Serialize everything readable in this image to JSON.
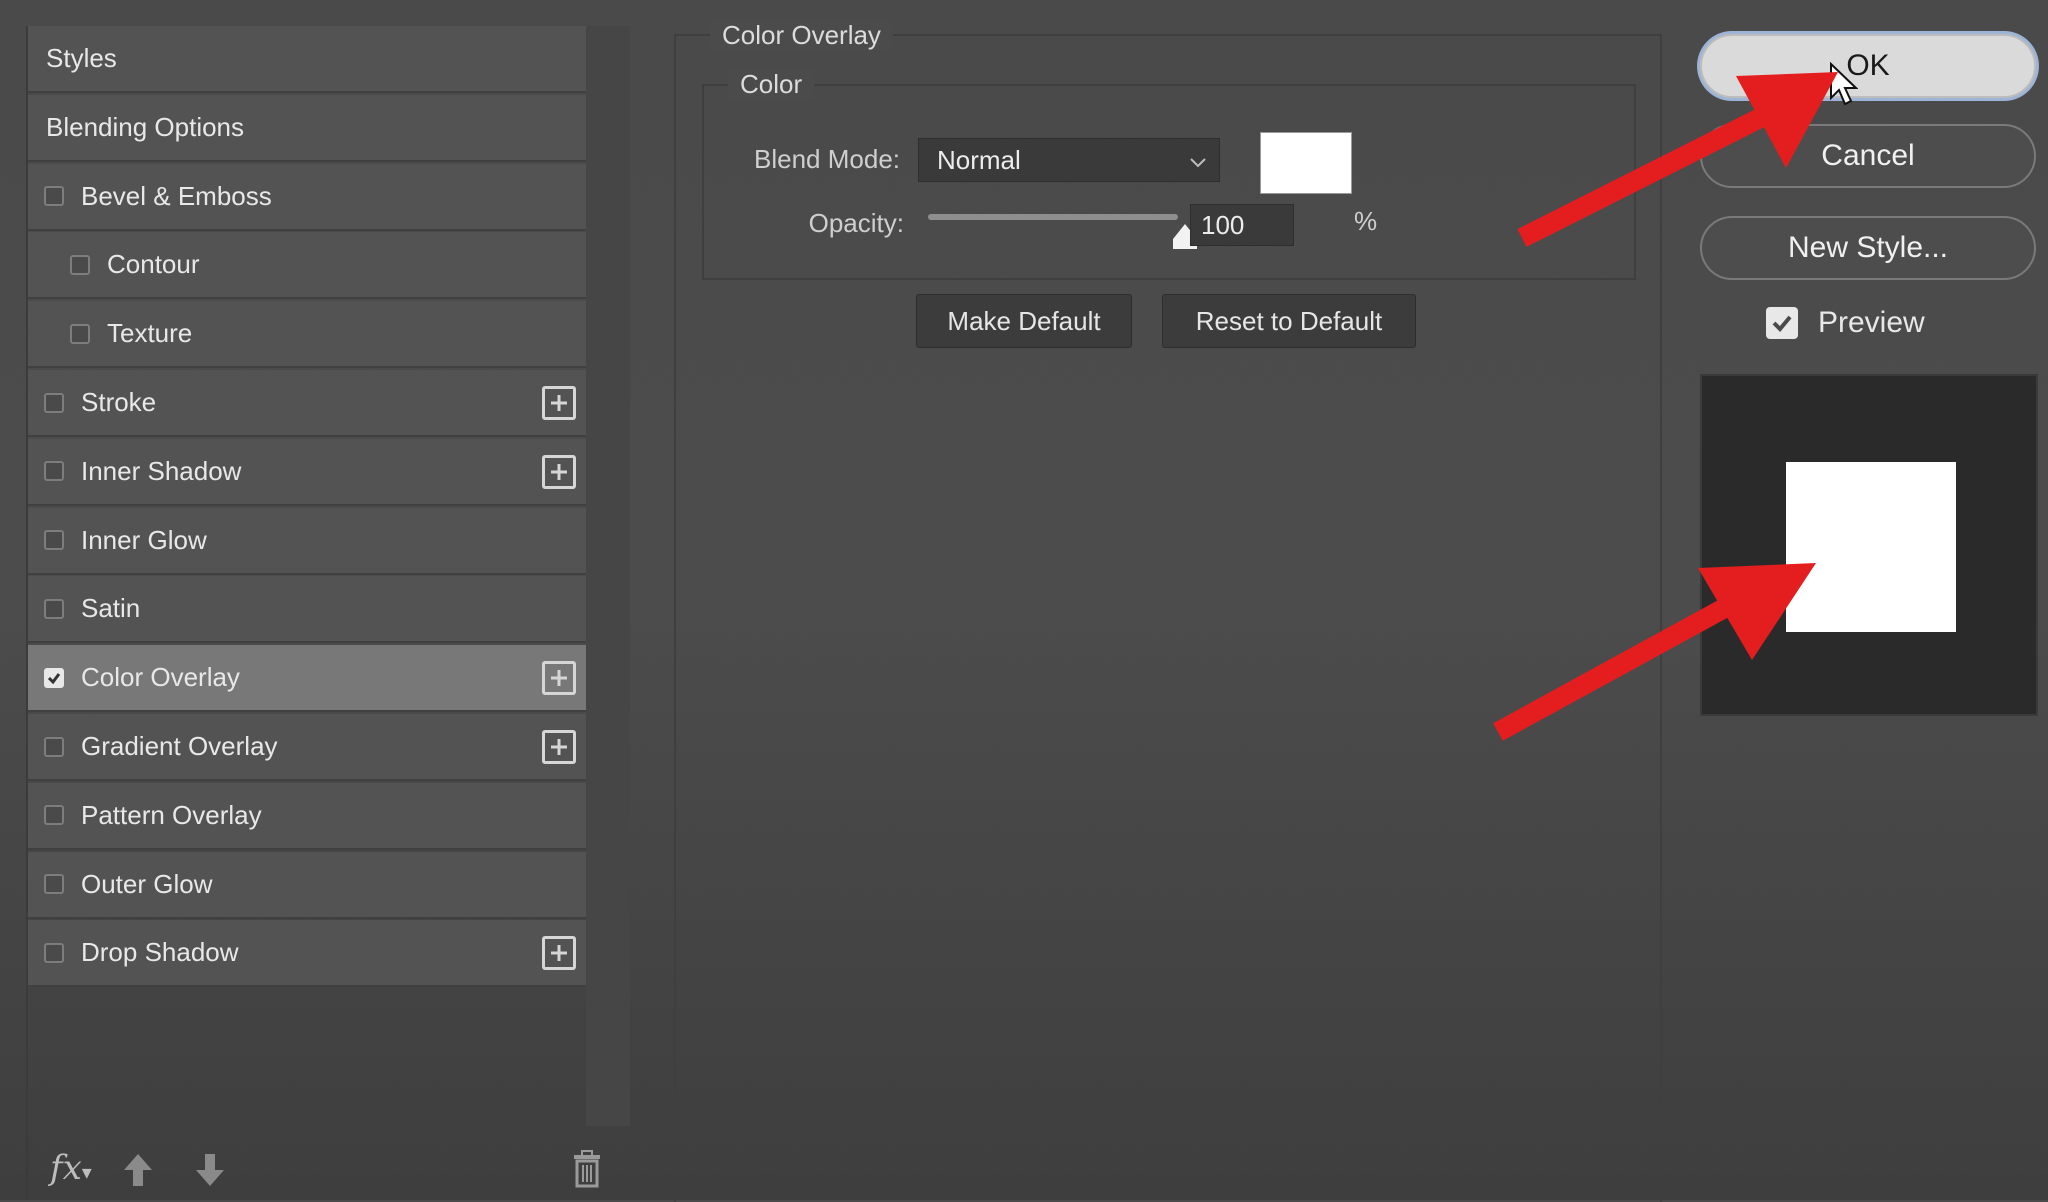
{
  "styles_panel": {
    "items": [
      {
        "label": "Styles",
        "type": "header",
        "indent": 0,
        "checked": false,
        "add": false
      },
      {
        "label": "Blending Options",
        "type": "header",
        "indent": 0,
        "checked": false,
        "add": false
      },
      {
        "label": "Bevel & Emboss",
        "type": "effect",
        "indent": 0,
        "checked": false,
        "add": false
      },
      {
        "label": "Contour",
        "type": "effect",
        "indent": 1,
        "checked": false,
        "add": false
      },
      {
        "label": "Texture",
        "type": "effect",
        "indent": 1,
        "checked": false,
        "add": false
      },
      {
        "label": "Stroke",
        "type": "effect",
        "indent": 0,
        "checked": false,
        "add": true
      },
      {
        "label": "Inner Shadow",
        "type": "effect",
        "indent": 0,
        "checked": false,
        "add": true
      },
      {
        "label": "Inner Glow",
        "type": "effect",
        "indent": 0,
        "checked": false,
        "add": false
      },
      {
        "label": "Satin",
        "type": "effect",
        "indent": 0,
        "checked": false,
        "add": false
      },
      {
        "label": "Color Overlay",
        "type": "effect",
        "indent": 0,
        "checked": true,
        "add": true,
        "selected": true
      },
      {
        "label": "Gradient Overlay",
        "type": "effect",
        "indent": 0,
        "checked": false,
        "add": true
      },
      {
        "label": "Pattern Overlay",
        "type": "effect",
        "indent": 0,
        "checked": false,
        "add": false
      },
      {
        "label": "Outer Glow",
        "type": "effect",
        "indent": 0,
        "checked": false,
        "add": false
      },
      {
        "label": "Drop Shadow",
        "type": "effect",
        "indent": 0,
        "checked": false,
        "add": true
      }
    ],
    "bottom": {
      "fx_label": "fx",
      "icons": [
        "fx-icon",
        "move-up-icon",
        "move-down-icon",
        "trash-icon"
      ]
    }
  },
  "color_overlay": {
    "section_title": "Color Overlay",
    "group_title": "Color",
    "blend_mode_label": "Blend Mode:",
    "blend_mode_value": "Normal",
    "swatch_color": "#ffffff",
    "opacity_label": "Opacity:",
    "opacity_value": "100",
    "opacity_unit": "%",
    "make_default": "Make Default",
    "reset_default": "Reset to Default"
  },
  "actions": {
    "ok": "OK",
    "cancel": "Cancel",
    "new_style": "New Style...",
    "preview_label": "Preview",
    "preview_checked": true
  },
  "colors": {
    "annotation_arrow": "#e41e1e",
    "selected_row": "#787878",
    "row": "#535353",
    "preview_bg": "#2a2a2a",
    "preview_square": "#ffffff"
  }
}
